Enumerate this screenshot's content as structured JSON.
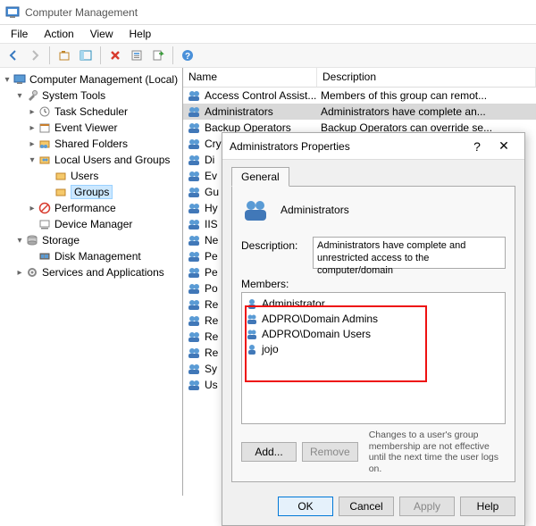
{
  "title": "Computer Management",
  "menu": {
    "file": "File",
    "action": "Action",
    "view": "View",
    "help": "Help"
  },
  "tree": {
    "root": "Computer Management (Local)",
    "systools": "System Tools",
    "tasksched": "Task Scheduler",
    "eventviewer": "Event Viewer",
    "sharedfolders": "Shared Folders",
    "localusers": "Local Users and Groups",
    "users": "Users",
    "groups": "Groups",
    "performance": "Performance",
    "devmgr": "Device Manager",
    "storage": "Storage",
    "diskmgmt": "Disk Management",
    "services": "Services and Applications"
  },
  "list": {
    "col_name": "Name",
    "col_desc": "Description",
    "rows": [
      {
        "name": "Access Control Assist...",
        "desc": "Members of this group can remot..."
      },
      {
        "name": "Administrators",
        "desc": "Administrators have complete an..."
      },
      {
        "name": "Backup Operators",
        "desc": "Backup Operators can override se..."
      },
      {
        "name": "Cry",
        "desc": ""
      },
      {
        "name": "Di",
        "desc": ""
      },
      {
        "name": "Ev",
        "desc": ""
      },
      {
        "name": "Gu",
        "desc": ""
      },
      {
        "name": "Hy",
        "desc": ""
      },
      {
        "name": "IIS",
        "desc": ""
      },
      {
        "name": "Ne",
        "desc": ""
      },
      {
        "name": "Pe",
        "desc": ""
      },
      {
        "name": "Pe",
        "desc": ""
      },
      {
        "name": "Po",
        "desc": ""
      },
      {
        "name": "Re",
        "desc": ""
      },
      {
        "name": "Re",
        "desc": ""
      },
      {
        "name": "Re",
        "desc": ""
      },
      {
        "name": "Re",
        "desc": ""
      },
      {
        "name": "Sy",
        "desc": ""
      },
      {
        "name": "Us",
        "desc": ""
      }
    ],
    "selected_index": 1
  },
  "dialog": {
    "title": "Administrators Properties",
    "tab_general": "General",
    "group_name": "Administrators",
    "desc_label": "Description:",
    "desc_value": "Administrators have complete and unrestricted access to the computer/domain",
    "members_label": "Members:",
    "members": [
      {
        "name": "Administrator",
        "type": "user"
      },
      {
        "name": "ADPRO\\Domain Admins",
        "type": "group"
      },
      {
        "name": "ADPRO\\Domain Users",
        "type": "group"
      },
      {
        "name": "jojo",
        "type": "user"
      }
    ],
    "add_btn": "Add...",
    "remove_btn": "Remove",
    "note": "Changes to a user's group membership are not effective until the next time the user logs on.",
    "ok": "OK",
    "cancel": "Cancel",
    "apply": "Apply",
    "help": "Help"
  }
}
